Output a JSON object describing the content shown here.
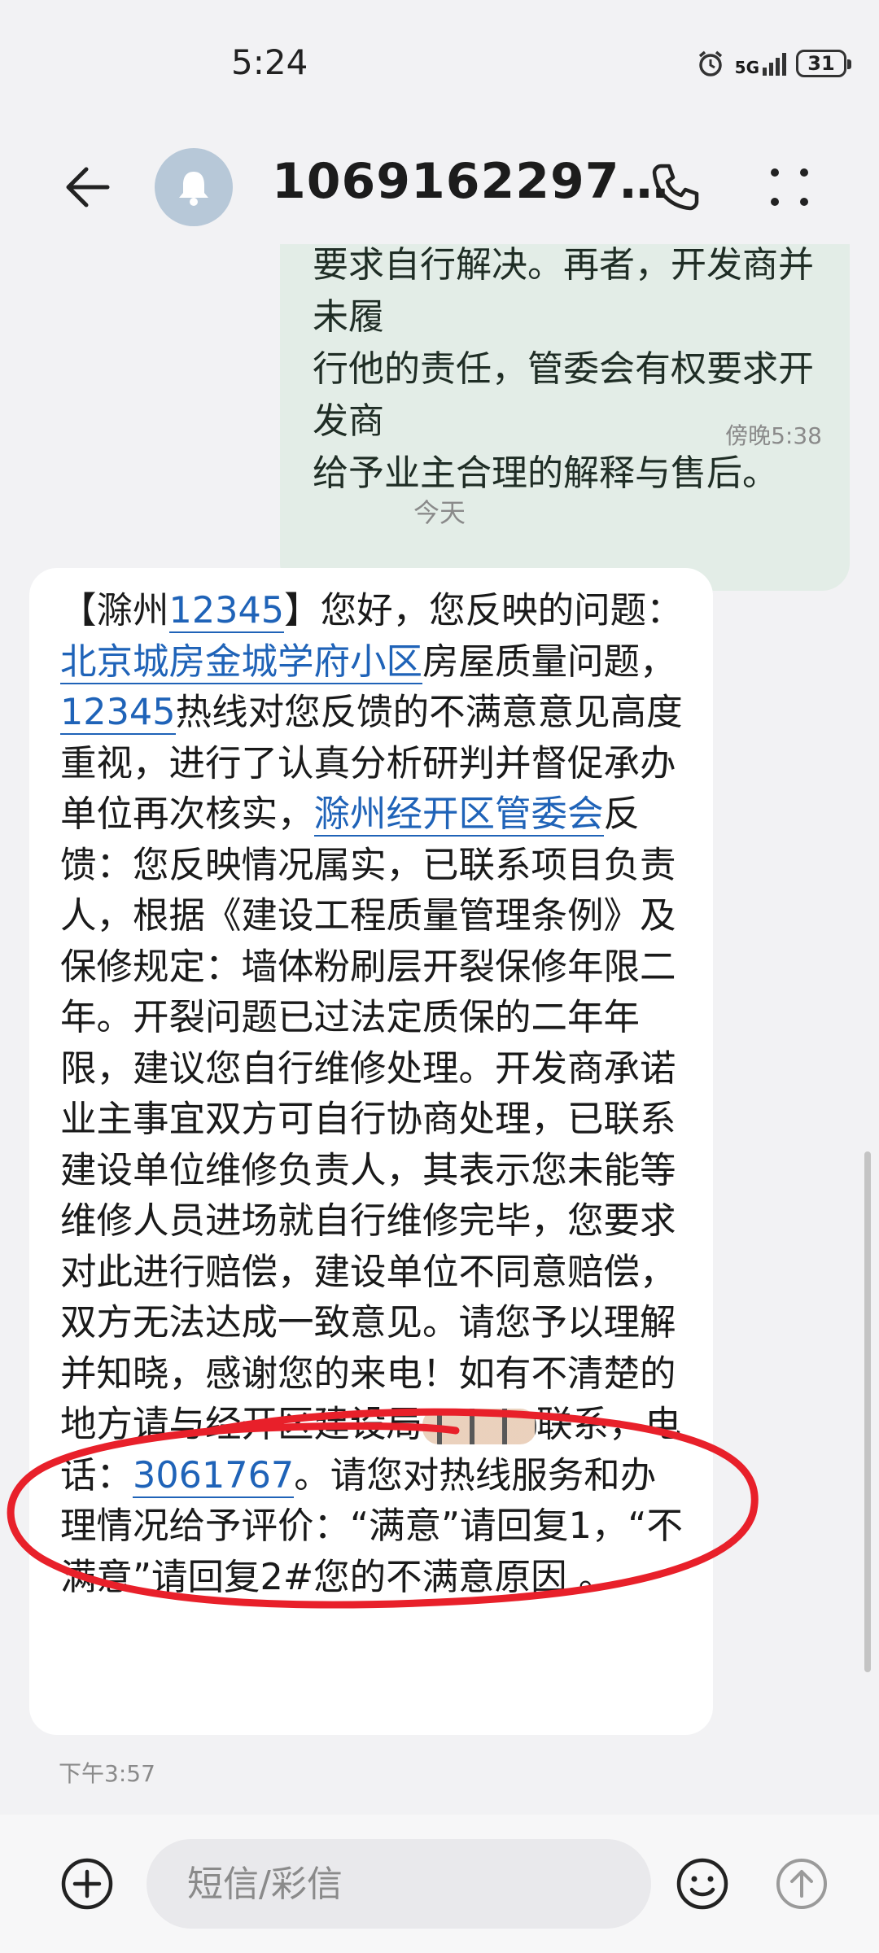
{
  "status_bar": {
    "time": "5:24",
    "network": "5G",
    "battery": "31"
  },
  "header": {
    "contact": "1069162297…"
  },
  "sent_message": {
    "lines": [
      "要求自行解决。再者，开发商并未履",
      "行他的责任，管委会有权要求开发商",
      "给予业主合理的解释与售后。"
    ],
    "time": "傍晚5:38"
  },
  "date_separator": "今天",
  "received_message": {
    "p1": "【滁州",
    "l1": "12345",
    "p2": "】您好，您反映的问题：",
    "l2": "北京城房金城学府小区",
    "p3": "房屋质量问题，",
    "l3": "12345",
    "p4": "热线对您反馈的不满意意见高度重视，进行了认真分析研判并督促承办单位再次核实，",
    "l4": "滁州经开区管委会",
    "p5": "反馈：您反映情况属实，已联系项目负责人，根据《建设工程质量管理条例》及保修规定：墙体粉刷层开裂保修年限二年。开裂问题已过法定质保的二年年限，建议您自行维修处理。开发商承诺业主事宜双方可自行协商处理，已联系建设单位维修负责人，其表示您未能等维修人员进场就自行维修完毕，您要求对此进行赔偿，建设单位不同意赔偿，双方无法达成一致意见。请您予以理解并知晓，感谢您的来电！如有不清楚的地方请与经开区建设局",
    "p6": "联系，电话：",
    "l5": "3061767",
    "p7": "。请您对热线服务和办理情况给予评价：“满意”请回复1，“不满意”请回复2#您的不满意原因 。",
    "time": "下午3:57"
  },
  "input": {
    "placeholder": "短信/彩信"
  },
  "colors": {
    "link": "#1f63b8",
    "sent_bubble": "#e3ede7",
    "annotation": "#e8202a"
  }
}
